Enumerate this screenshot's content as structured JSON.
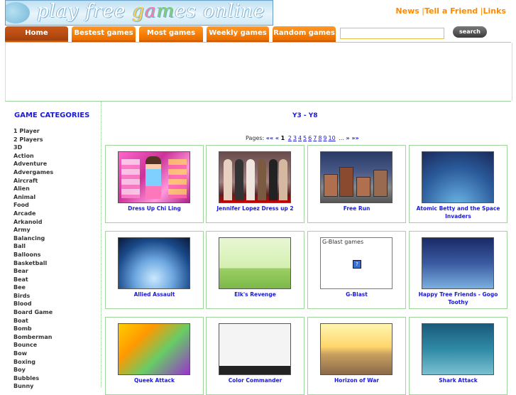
{
  "logo": {
    "parts": [
      "play free ",
      "g",
      "a",
      "m",
      "es online"
    ]
  },
  "toplinks": [
    "News",
    "Tell a Friend",
    "Links"
  ],
  "nav": {
    "tabs": [
      "Home",
      "Bestest games",
      "Most games",
      "Weekly games",
      "Random games"
    ],
    "search_button": "search"
  },
  "sidebar": {
    "title": "GAME CATEGORIES",
    "categories": [
      "1 Player",
      "2 Players",
      "3D",
      "Action",
      "Adventure",
      "Advergames",
      "Aircraft",
      "Alien",
      "Animal",
      "Food",
      "Arcade",
      "Arkanoid",
      "Army",
      "Balancing",
      "Ball",
      "Balloons",
      "Basketball",
      "Bear",
      "Beat",
      "Bee",
      "Birds",
      "Blood",
      "Board Game",
      "Boat",
      "Bomb",
      "Bomberman",
      "Bounce",
      "Bow",
      "Boxing",
      "Boy",
      "Bubbles",
      "Bunny"
    ]
  },
  "content": {
    "title": "Y3 - Y8",
    "pagination": {
      "label": "Pages:",
      "first": "«« «",
      "current": "1",
      "pages": [
        "2",
        "3",
        "4",
        "5",
        "6",
        "7",
        "8",
        "9",
        "10"
      ],
      "ellipsis": "...",
      "next": "» »»"
    },
    "games": [
      "Dress Up Chi Ling",
      "Jennifer Lopez Dress up 2",
      "Free Run",
      "Atomic Betty and the Space Invaders",
      "Allied Assault",
      "Elk's Revenge",
      "G-Blast",
      "Happy Tree Friends - Gogo Toothy",
      "Queek Attack",
      "Color Commander",
      "Horizon of War",
      "Shark Attack"
    ],
    "gblast_thumb_text": "G-Blast games",
    "gblast_thumb_icon": "?"
  }
}
